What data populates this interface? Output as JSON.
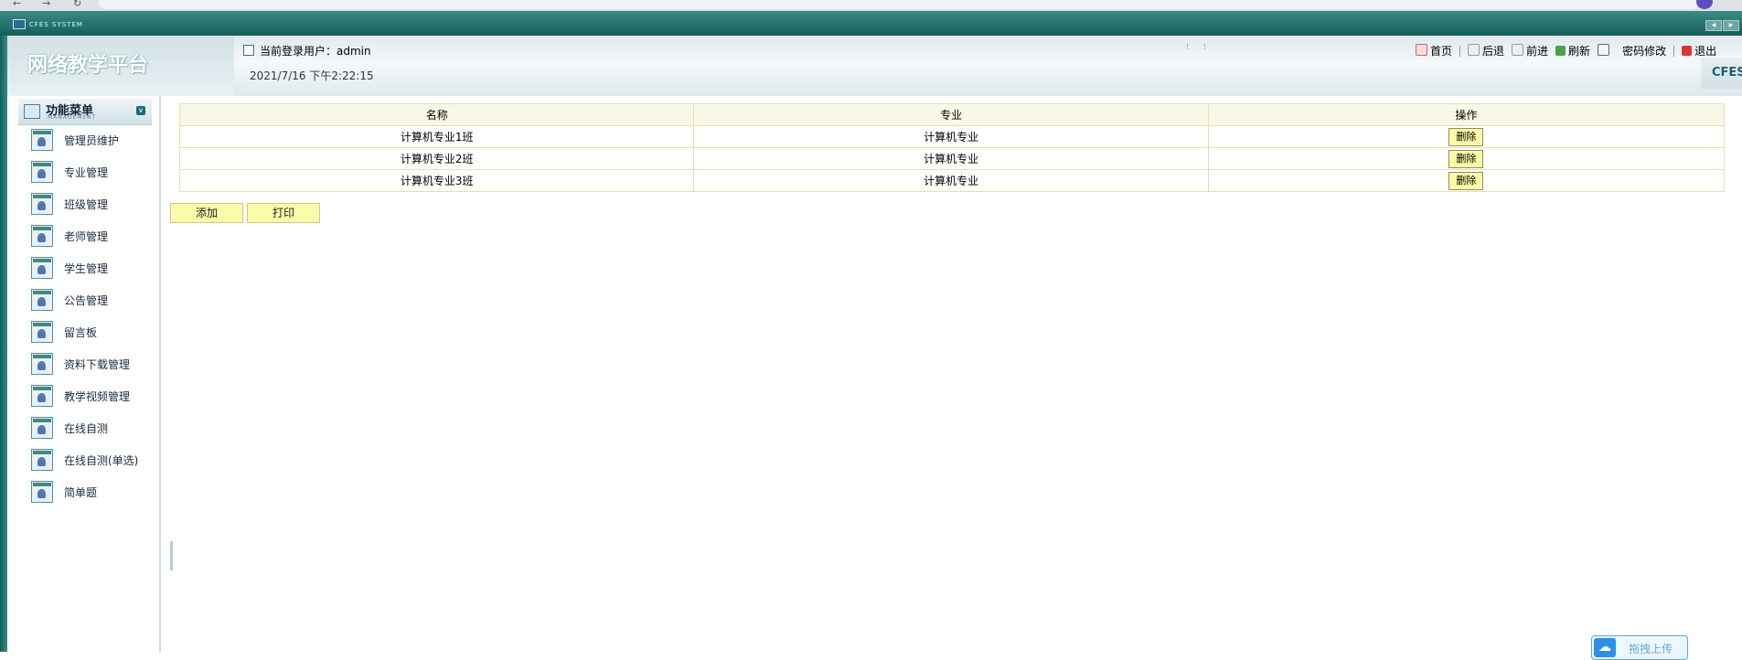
{
  "app": {
    "window_title": "CFES SYSTEM",
    "platform_title": "网络教学平台",
    "brand": "CFES"
  },
  "header": {
    "current_user_label": "当前登录用户：admin",
    "datetime": "2021/7/16 下午2:22:15"
  },
  "toolbar": {
    "home": "首页",
    "back": "后退",
    "forward": "前进",
    "refresh": "刷新",
    "change_password": "密码修改",
    "logout": "退出"
  },
  "sidebar": {
    "title": "功能菜单",
    "subtitle": "MANAGEMENT",
    "items": [
      {
        "label": "管理员维护",
        "icon": "user-card-icon"
      },
      {
        "label": "专业管理",
        "icon": "user-card-icon"
      },
      {
        "label": "班级管理",
        "icon": "user-card-icon"
      },
      {
        "label": "老师管理",
        "icon": "user-card-icon"
      },
      {
        "label": "学生管理",
        "icon": "user-card-icon"
      },
      {
        "label": "公告管理",
        "icon": "user-card-icon"
      },
      {
        "label": "留言板",
        "icon": "user-card-icon"
      },
      {
        "label": "资料下载管理",
        "icon": "user-card-icon"
      },
      {
        "label": "教学视频管理",
        "icon": "user-card-icon"
      },
      {
        "label": "在线自测",
        "icon": "user-card-icon"
      },
      {
        "label": "在线自测(单选)",
        "icon": "user-card-icon"
      },
      {
        "label": "简单题",
        "icon": "user-card-icon"
      }
    ]
  },
  "table": {
    "columns": [
      "名称",
      "专业",
      "操作"
    ],
    "rows": [
      {
        "name": "计算机专业1班",
        "major": "计算机专业",
        "action": "删除"
      },
      {
        "name": "计算机专业2班",
        "major": "计算机专业",
        "action": "删除"
      },
      {
        "name": "计算机专业3班",
        "major": "计算机专业",
        "action": "删除"
      }
    ]
  },
  "actions": {
    "add": "添加",
    "print": "打印"
  },
  "upload_widget": {
    "label": "拖拽上传"
  },
  "colors": {
    "frame_teal": "#155e5a",
    "table_border": "#e3e0b4",
    "button_yellow": "#fbfba8"
  }
}
